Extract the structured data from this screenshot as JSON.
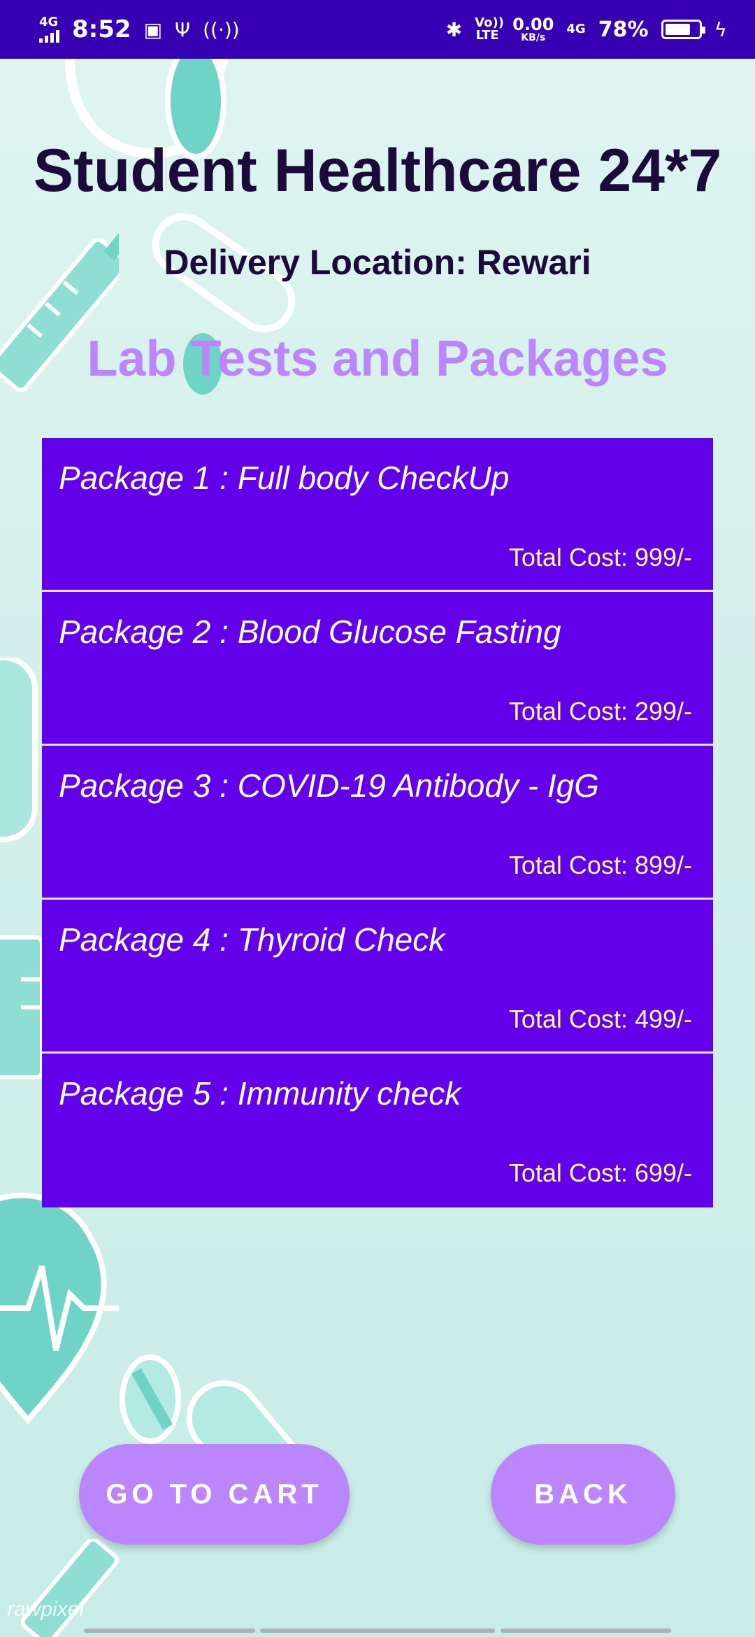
{
  "status_bar": {
    "network_left": "4G",
    "time": "8:52",
    "volte": "Vo)) LTE",
    "speed_value": "0.00",
    "speed_unit": "KB/s",
    "network_right": "4G",
    "battery_pct": "78%",
    "battery_level": 0.78
  },
  "header": {
    "app_title": "Student Healthcare 24*7",
    "delivery_location": "Delivery Location: Rewari",
    "section_title": "Lab Tests and Packages"
  },
  "packages": [
    {
      "name": "Package 1 : Full body CheckUp",
      "cost": "Total Cost: 999/-"
    },
    {
      "name": "Package 2 : Blood Glucose Fasting",
      "cost": "Total Cost: 299/-"
    },
    {
      "name": "Package 3 : COVID-19 Antibody - IgG",
      "cost": "Total Cost: 899/-"
    },
    {
      "name": "Package 4 : Thyroid Check",
      "cost": "Total Cost: 499/-"
    },
    {
      "name": "Package 5 : Immunity check",
      "cost": "Total Cost: 699/-"
    }
  ],
  "buttons": {
    "go_to_cart": "GO TO  CART",
    "back": "BACK"
  },
  "watermark": "rawpixel",
  "colors": {
    "status_bar": "#3700b3",
    "package_bg": "#6200ea",
    "accent": "#bb86fc",
    "cost_text": "#fff6a8",
    "title_text": "#1c0a3a"
  }
}
